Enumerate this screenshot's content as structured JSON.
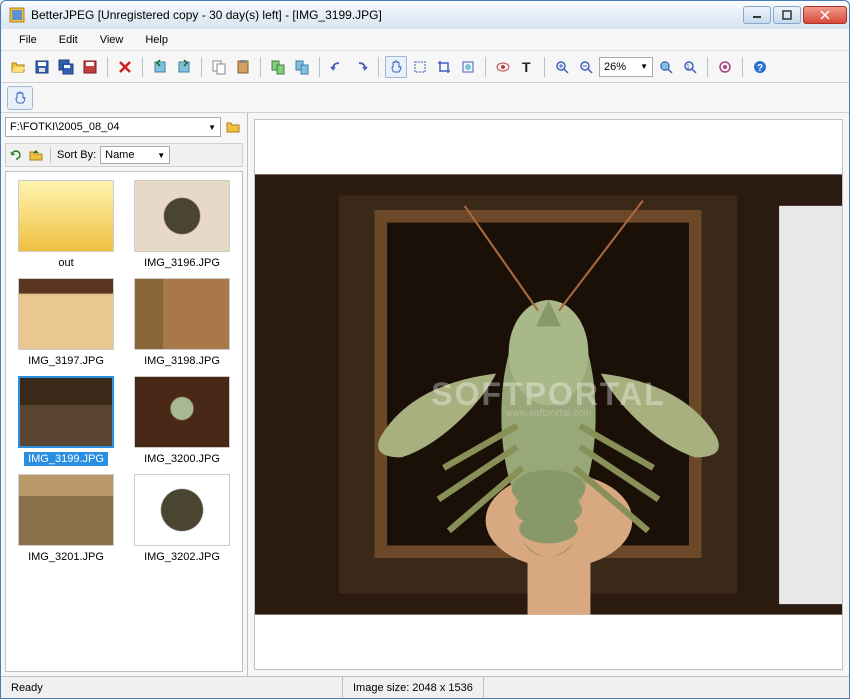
{
  "title": "BetterJPEG [Unregistered copy - 30 day(s) left] - [IMG_3199.JPG]",
  "menu": {
    "file": "File",
    "edit": "Edit",
    "view": "View",
    "help": "Help"
  },
  "toolbar": {
    "zoom": "26%"
  },
  "sidebar": {
    "path": "F:\\FOTKI\\2005_08_04",
    "sort_label": "Sort By:",
    "sort_value": "Name",
    "items": [
      {
        "label": "out",
        "cls": "folder-thumb"
      },
      {
        "label": "IMG_3196.JPG",
        "cls": "ph1"
      },
      {
        "label": "IMG_3197.JPG",
        "cls": "ph2"
      },
      {
        "label": "IMG_3198.JPG",
        "cls": "ph3"
      },
      {
        "label": "IMG_3199.JPG",
        "cls": "ph4",
        "selected": true
      },
      {
        "label": "IMG_3200.JPG",
        "cls": "ph5"
      },
      {
        "label": "IMG_3201.JPG",
        "cls": "ph6"
      },
      {
        "label": "IMG_3202.JPG",
        "cls": "ph7"
      }
    ]
  },
  "status": {
    "ready": "Ready",
    "size": "Image size:  2048 x 1536"
  },
  "watermark": {
    "main": "SOFTPORTAL",
    "sub": "www.softportal.com"
  }
}
